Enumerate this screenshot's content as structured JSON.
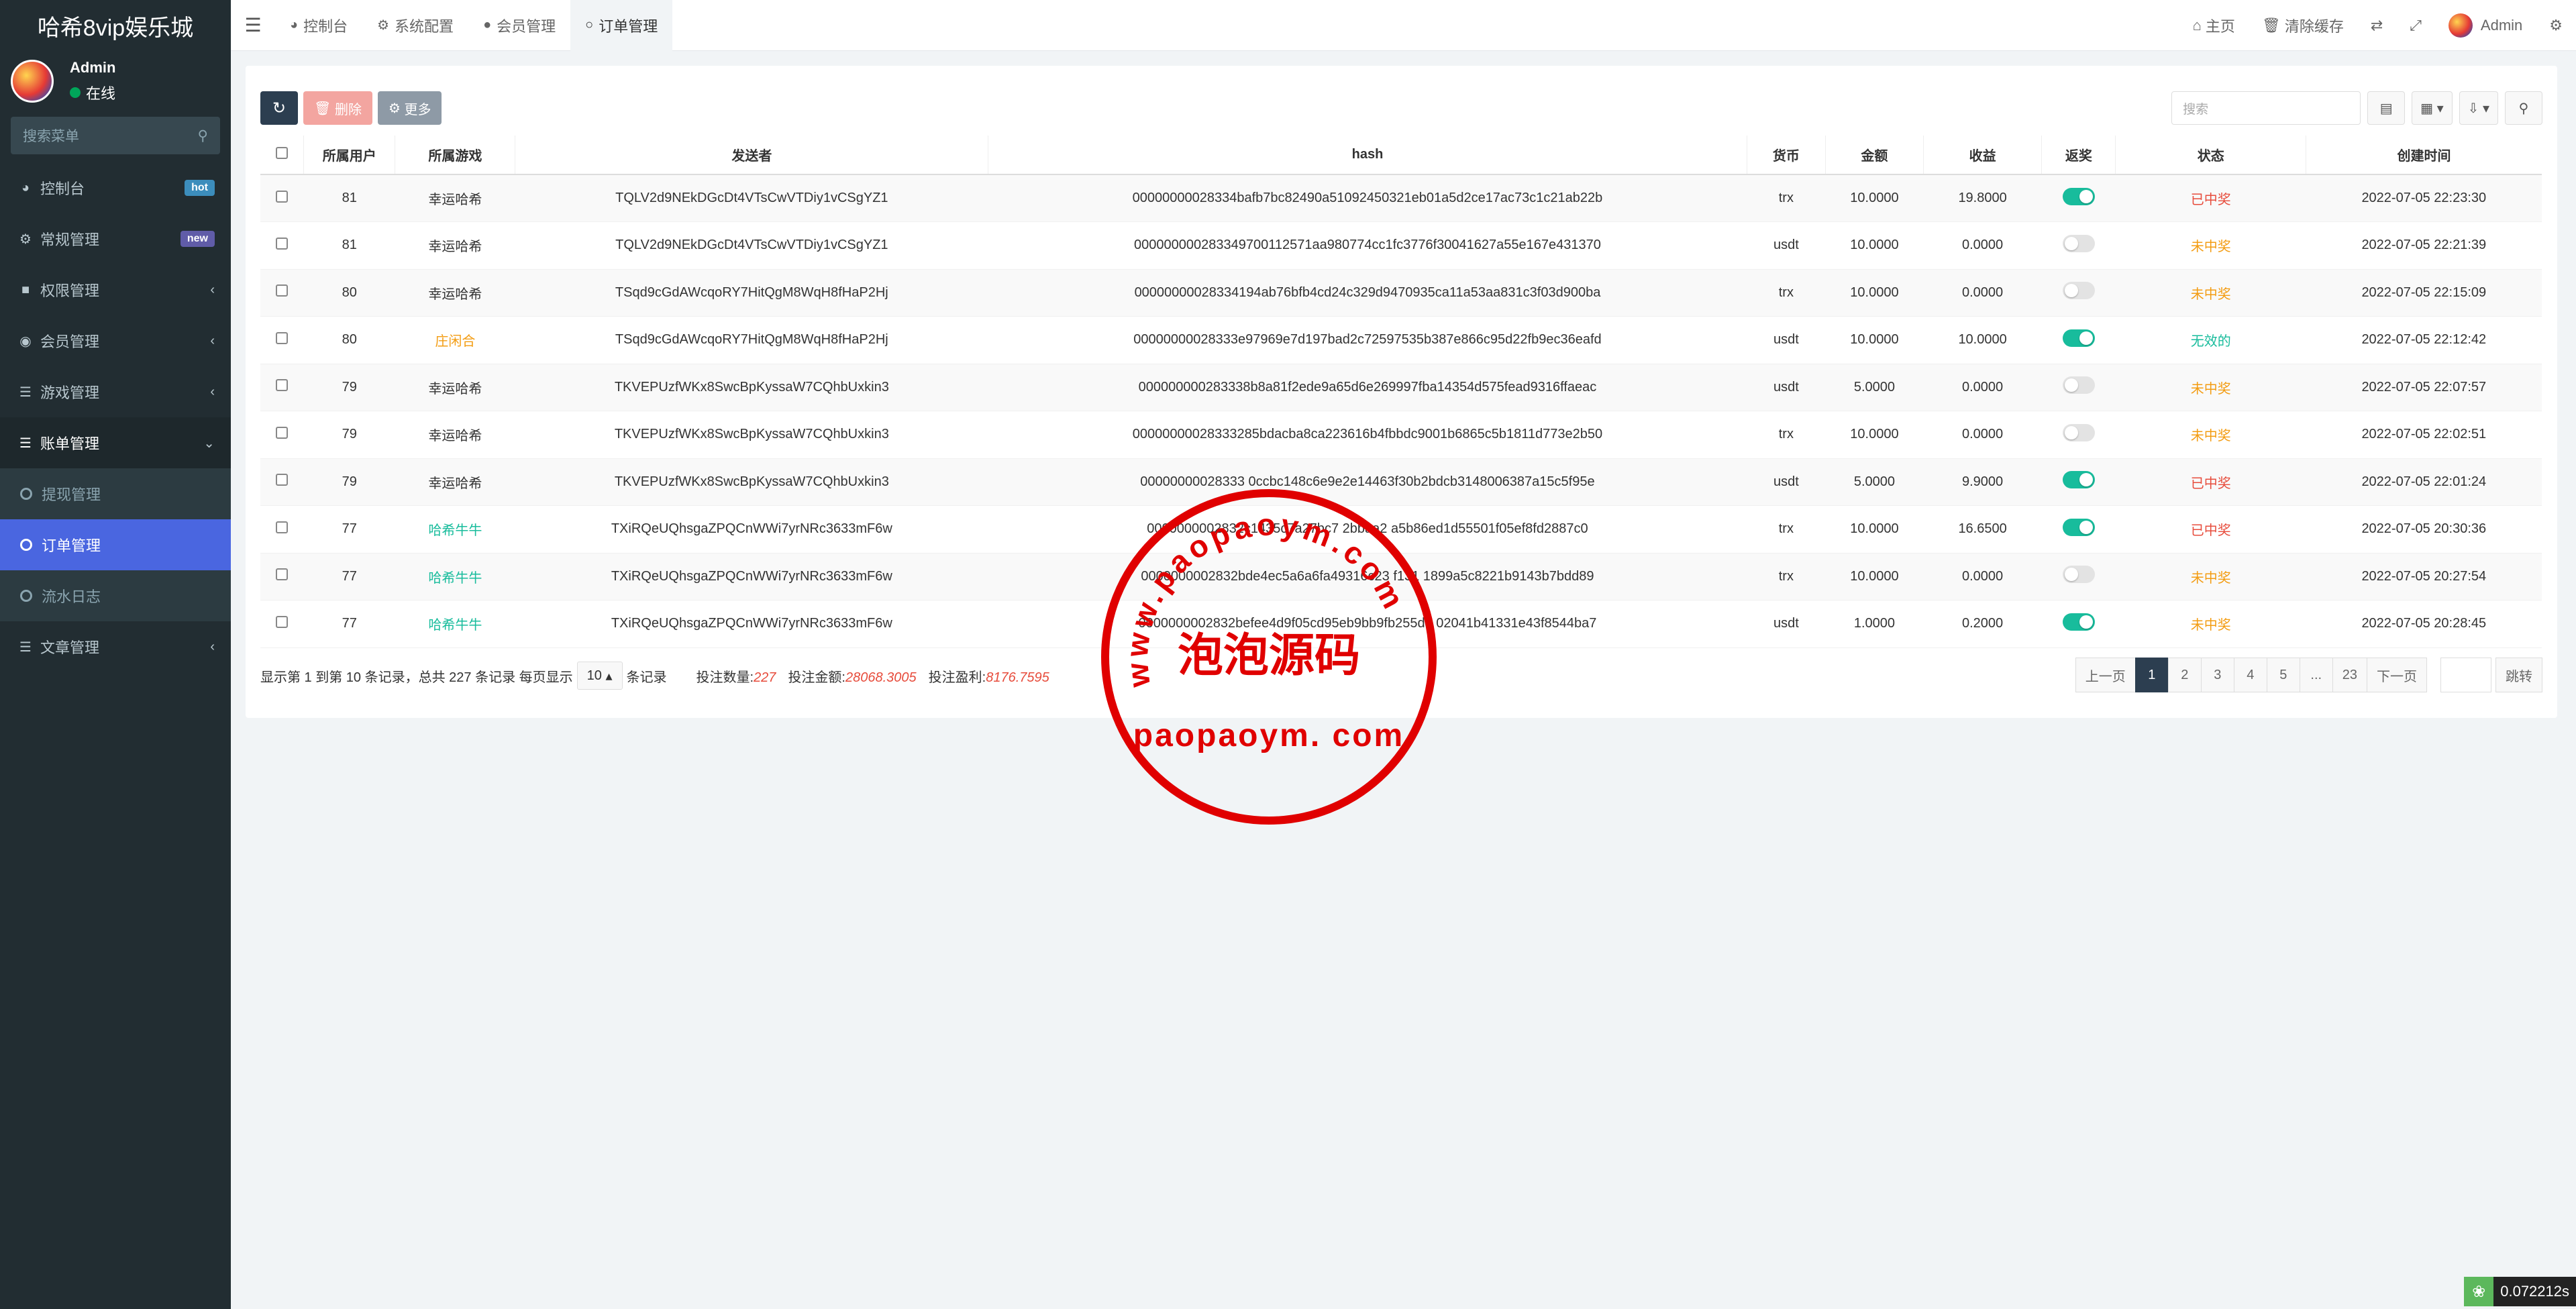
{
  "brand": "哈希8vip娱乐城",
  "user": {
    "name": "Admin",
    "status": "在线"
  },
  "sidebar": {
    "search_placeholder": "搜索菜单",
    "items": [
      {
        "label": "控制台",
        "icon": "dashboard-icon",
        "badge": "hot"
      },
      {
        "label": "常规管理",
        "icon": "cogs-icon",
        "badge": "new"
      },
      {
        "label": "权限管理",
        "icon": "group-icon"
      },
      {
        "label": "会员管理",
        "icon": "user-circle-icon"
      },
      {
        "label": "游戏管理",
        "icon": "list-icon"
      },
      {
        "label": "账单管理",
        "icon": "list-icon"
      }
    ],
    "subitems": [
      {
        "label": "提现管理"
      },
      {
        "label": "订单管理"
      },
      {
        "label": "流水日志"
      }
    ],
    "last_item": {
      "label": "文章管理",
      "icon": "list-icon"
    }
  },
  "topbar": {
    "tabs": [
      {
        "label": "控制台",
        "icon": "dashboard-icon"
      },
      {
        "label": "系统配置",
        "icon": "gear-icon"
      },
      {
        "label": "会员管理",
        "icon": "user-icon"
      },
      {
        "label": "订单管理",
        "icon": "circle-icon"
      }
    ],
    "home": "主页",
    "clear_cache": "清除缓存",
    "admin": "Admin"
  },
  "toolbar": {
    "delete": "删除",
    "more": "更多",
    "search_placeholder": "搜索"
  },
  "table": {
    "headers": [
      "所属用户",
      "所属游戏",
      "发送者",
      "hash",
      "货币",
      "金额",
      "收益",
      "返奖",
      "状态",
      "创建时间"
    ],
    "rows": [
      {
        "user": "81",
        "game": "幸运哈希",
        "game_style": "normal",
        "sender": "TQLV2d9NEkDGcDt4VTsCwVTDiy1vCSgYZ1",
        "hash": "00000000028334bafb7bc82490a51092450321eb01a5d2ce17ac73c1c21ab22b",
        "currency": "trx",
        "amount": "10.0000",
        "profit": "19.8000",
        "refund": true,
        "status": "已中奖",
        "status_style": "red",
        "time": "2022-07-05 22:23:30"
      },
      {
        "user": "81",
        "game": "幸运哈希",
        "game_style": "normal",
        "sender": "TQLV2d9NEkDGcDt4VTsCwVTDiy1vCSgYZ1",
        "hash": "000000000283349700112571aa980774cc1fc3776f30041627a55e167e431370",
        "currency": "usdt",
        "amount": "10.0000",
        "profit": "0.0000",
        "refund": false,
        "status": "未中奖",
        "status_style": "orange",
        "time": "2022-07-05 22:21:39"
      },
      {
        "user": "80",
        "game": "幸运哈希",
        "game_style": "normal",
        "sender": "TSqd9cGdAWcqoRY7HitQgM8WqH8fHaP2Hj",
        "hash": "00000000028334194ab76bfb4cd24c329d9470935ca11a53aa831c3f03d900ba",
        "currency": "trx",
        "amount": "10.0000",
        "profit": "0.0000",
        "refund": false,
        "status": "未中奖",
        "status_style": "orange",
        "time": "2022-07-05 22:15:09"
      },
      {
        "user": "80",
        "game": "庄闲合",
        "game_style": "orange",
        "sender": "TSqd9cGdAWcqoRY7HitQgM8WqH8fHaP2Hj",
        "hash": "00000000028333e97969e7d197bad2c72597535b387e866c95d22fb9ec36eafd",
        "currency": "usdt",
        "amount": "10.0000",
        "profit": "10.0000",
        "refund": true,
        "status": "无效的",
        "status_style": "green",
        "time": "2022-07-05 22:12:42"
      },
      {
        "user": "79",
        "game": "幸运哈希",
        "game_style": "normal",
        "sender": "TKVEPUzfWKx8SwcBpKyssaW7CQhbUxkin3",
        "hash": "000000000283338b8a81f2ede9a65d6e269997fba14354d575fead9316ffaeac",
        "currency": "usdt",
        "amount": "5.0000",
        "profit": "0.0000",
        "refund": false,
        "status": "未中奖",
        "status_style": "orange",
        "time": "2022-07-05 22:07:57"
      },
      {
        "user": "79",
        "game": "幸运哈希",
        "game_style": "normal",
        "sender": "TKVEPUzfWKx8SwcBpKyssaW7CQhbUxkin3",
        "hash": "00000000028333285bdacba8ca223616b4fbbdc9001b6865c5b1811d773e2b50",
        "currency": "trx",
        "amount": "10.0000",
        "profit": "0.0000",
        "refund": false,
        "status": "未中奖",
        "status_style": "orange",
        "time": "2022-07-05 22:02:51"
      },
      {
        "user": "79",
        "game": "幸运哈希",
        "game_style": "normal",
        "sender": "TKVEPUzfWKx8SwcBpKyssaW7CQhbUxkin3",
        "hash": "00000000028333 0ccbc148c6e9e2e14463f30b2bdcb3148006387a15c5f95e",
        "currency": "usdt",
        "amount": "5.0000",
        "profit": "9.9000",
        "refund": true,
        "status": "已中奖",
        "status_style": "red",
        "time": "2022-07-05 22:01:24"
      },
      {
        "user": "77",
        "game": "哈希牛牛",
        "game_style": "teal",
        "sender": "TXiRQeUQhsgaZPQCnWWi7yrNRc3633mF6w",
        "hash": "0000000002832c1435c7a27bc7 2bbaa2 a5b86ed1d55501f05ef8fd2887c0",
        "currency": "trx",
        "amount": "10.0000",
        "profit": "16.6500",
        "refund": true,
        "status": "已中奖",
        "status_style": "red",
        "time": "2022-07-05 20:30:36"
      },
      {
        "user": "77",
        "game": "哈希牛牛",
        "game_style": "teal",
        "sender": "TXiRQeUQhsgaZPQCnWWi7yrNRc3633mF6w",
        "hash": "0000000002832bde4ec5a6a6fa49316c23 f131 1899a5c8221b9143b7bdd89",
        "currency": "trx",
        "amount": "10.0000",
        "profit": "0.0000",
        "refund": false,
        "status": "未中奖",
        "status_style": "orange",
        "time": "2022-07-05 20:27:54"
      },
      {
        "user": "77",
        "game": "哈希牛牛",
        "game_style": "teal",
        "sender": "TXiRQeUQhsgaZPQCnWWi7yrNRc3633mF6w",
        "hash": "0000000002832befee4d9f05cd95eb9bb9fb255d7 02041b41331e43f8544ba7",
        "currency": "usdt",
        "amount": "1.0000",
        "profit": "0.2000",
        "refund": true,
        "status": "未中奖",
        "status_style": "orange",
        "time": "2022-07-05 20:28:45"
      }
    ]
  },
  "footer": {
    "summary": "显示第 1 到第 10 条记录，总共 227 条记录 每页显示",
    "page_size": "10",
    "records_suffix": "条记录",
    "bet_count_label": "投注数量:",
    "bet_count": "227",
    "bet_amount_label": "投注金额:",
    "bet_amount": "28068.3005",
    "bet_profit_label": "投注盈利:",
    "bet_profit": "8176.7595"
  },
  "pagination": {
    "prev": "上一页",
    "pages": [
      "1",
      "2",
      "3",
      "4",
      "5",
      "...",
      "23"
    ],
    "next": "下一页",
    "jump": "跳转"
  },
  "watermark": {
    "url": "www.paopaoym.com",
    "title": "泡泡源码",
    "domain": "paopaoym. com"
  },
  "perf": {
    "time": "0.072212s"
  },
  "colors": {
    "sidebar_bg": "#222d32",
    "active_menu": "#4a66e0",
    "toggle_on": "#18bc9c",
    "status_win": "#e74c3c",
    "status_lose": "#f39c12"
  }
}
